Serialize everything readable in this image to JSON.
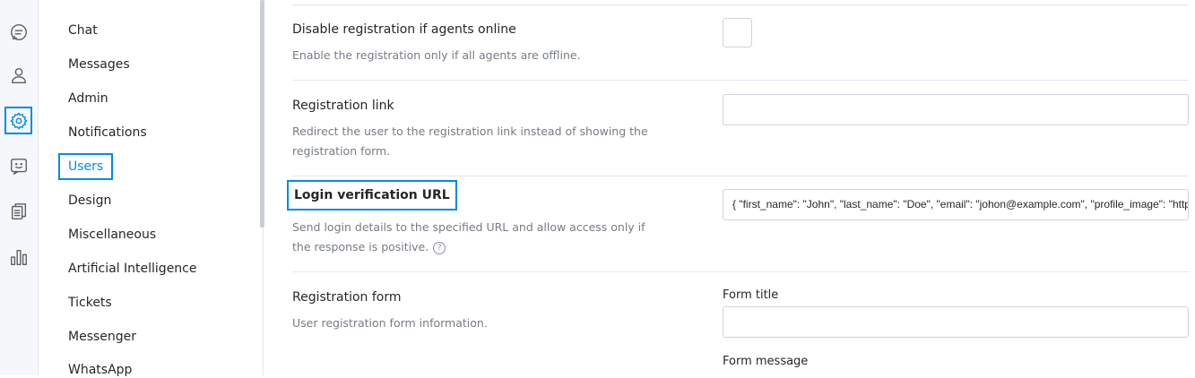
{
  "rail": {
    "icons": [
      "chat-icon",
      "user-icon",
      "gear-icon",
      "chatbot-icon",
      "documents-icon",
      "reports-icon"
    ]
  },
  "nav": {
    "items": [
      "Chat",
      "Messages",
      "Admin",
      "Notifications",
      "Users",
      "Design",
      "Miscellaneous",
      "Artificial Intelligence",
      "Tickets",
      "Messenger",
      "WhatsApp"
    ],
    "active": "Users"
  },
  "settings": {
    "disable_registration": {
      "title": "Disable registration if agents online",
      "description": "Enable the registration only if all agents are offline.",
      "checked": false
    },
    "registration_link": {
      "title": "Registration link",
      "description": "Redirect the user to the registration link instead of showing the registration form.",
      "value": ""
    },
    "login_verification": {
      "title": "Login verification URL",
      "description": "Send login details to the specified URL and allow access only if the response is positive.",
      "help": "?",
      "value": "{ \"first_name\": \"John\", \"last_name\": \"Doe\", \"email\": \"johon@example.com\", \"profile_image\": \"https://example.com/image.jpg\" }"
    },
    "registration_form": {
      "title": "Registration form",
      "description": "User registration form information.",
      "form_title_label": "Form title",
      "form_title_value": "",
      "form_message_label": "Form message"
    }
  },
  "colors": {
    "accent": "#028be5",
    "border": "#cfd4da",
    "text": "#24272a",
    "muted": "#767c84"
  }
}
